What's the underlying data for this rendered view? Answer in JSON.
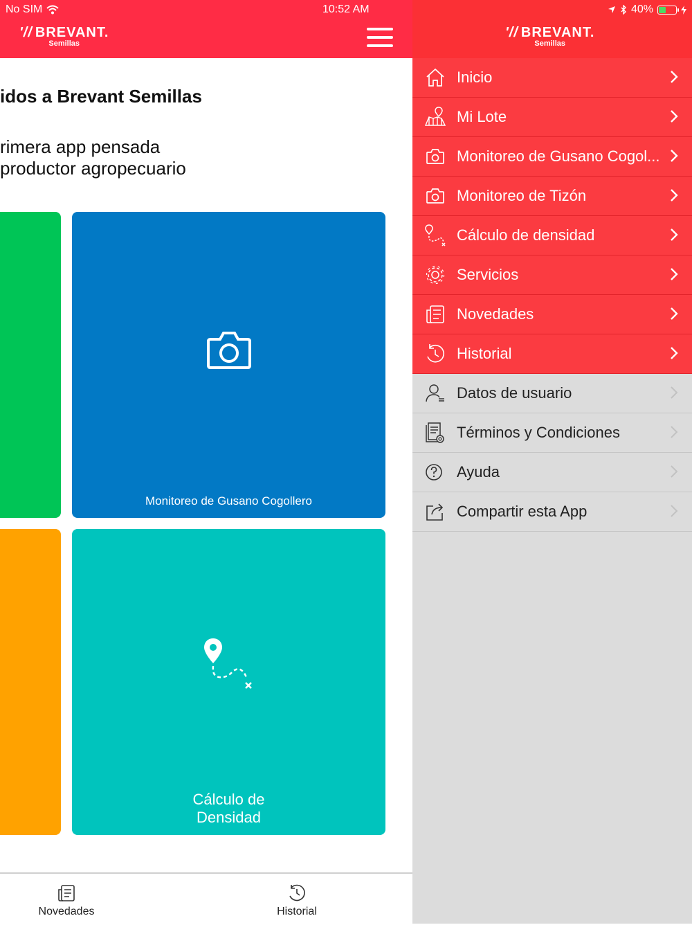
{
  "status": {
    "carrier": "No SIM",
    "time": "10:52 AM",
    "battery": "40%",
    "battery_level": 0.4
  },
  "app": {
    "brand": "BREVANT.",
    "brand_sub": "Semillas"
  },
  "home": {
    "welcome_title": "idos a Brevant Semillas",
    "welcome_line1": "rimera app pensada",
    "welcome_line2": "productor agropecuario",
    "tiles": [
      {
        "label": "",
        "color": "#00c556"
      },
      {
        "label": "Monitoreo de Gusano Cogollero",
        "icon": "camera-icon",
        "color": "#0279c5"
      },
      {
        "label": "",
        "color": "#ffa200"
      },
      {
        "label_line1": "Cálculo de",
        "label_line2": "Densidad",
        "icon": "route-pin-icon",
        "color": "#00c4bd"
      }
    ]
  },
  "tabbar": {
    "tabs": [
      {
        "label": "Novedades",
        "icon": "news-icon"
      },
      {
        "label": "Historial",
        "icon": "history-icon"
      }
    ]
  },
  "menu": {
    "items": [
      {
        "label": "Inicio",
        "icon": "home-icon"
      },
      {
        "label": "Mi Lote",
        "icon": "map-pin-icon"
      },
      {
        "label": "Monitoreo de Gusano Cogol...",
        "icon": "camera-icon"
      },
      {
        "label": "Monitoreo de Tizón",
        "icon": "camera-icon"
      },
      {
        "label": "Cálculo de densidad",
        "icon": "route-pin-icon"
      },
      {
        "label": "Servicios",
        "icon": "gear-icon"
      },
      {
        "label": "Novedades",
        "icon": "news-icon"
      },
      {
        "label": "Historial",
        "icon": "history-icon"
      },
      {
        "label": "Datos de usuario",
        "icon": "user-icon"
      },
      {
        "label": "Términos y Condiciones",
        "icon": "document-icon"
      },
      {
        "label": "Ayuda",
        "icon": "help-icon"
      },
      {
        "label": "Compartir esta App",
        "icon": "share-icon"
      }
    ]
  },
  "colors": {
    "header_red": "#ff2c45",
    "menu_red": "#fb3b41",
    "menu_gray": "#dcdcdc"
  }
}
